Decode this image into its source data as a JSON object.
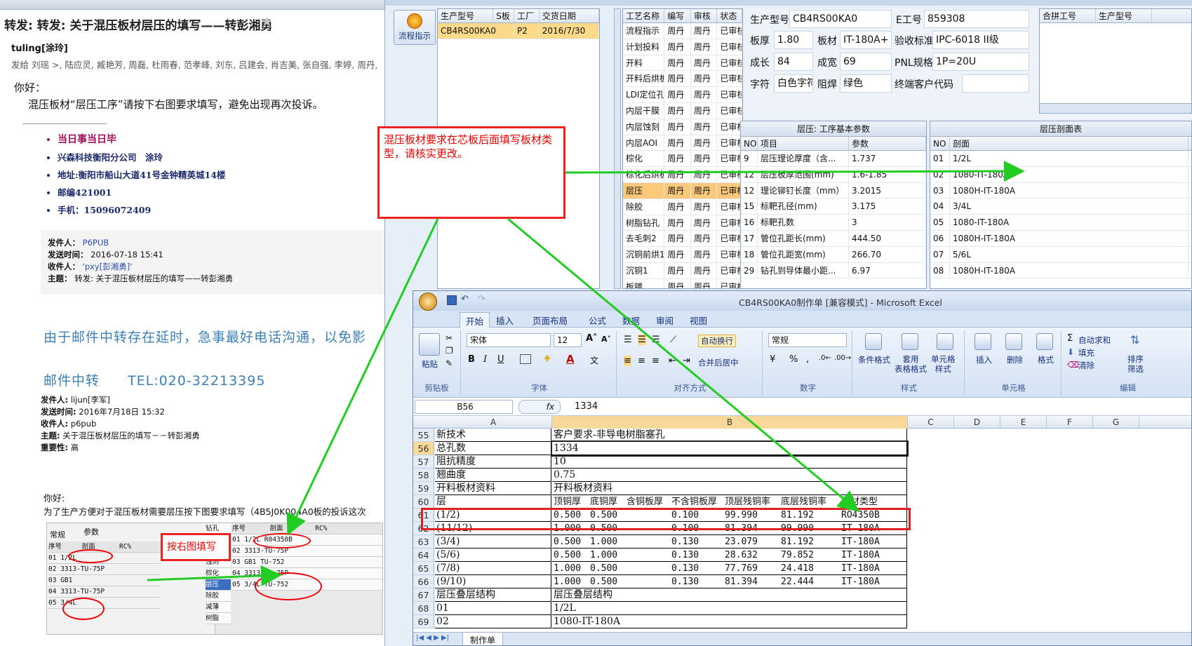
{
  "email": {
    "subject": "转发: 转发: 关于混压板材层压的填写——转彭湘勇",
    "sender": "tuling[涂玲]",
    "recipients": "发给 刘瑶 >, 陆应灵, 臧艳芳, 周磊, 杜雨春, 范孝峰, 刘东, 吕建会, 肖吉美, 张自强, 李婷, 周丹,",
    "greeting": "你好：",
    "request": "混压板材“层压工序”请按下右图要求填写，避免出现再次投诉。",
    "signature": [
      "当日事当日毕",
      "兴森科技衡阳分公司　涂玲",
      "地址:衡阳市船山大道41号金钟精英城14楼",
      "邮编421001",
      "手机：15096072409"
    ],
    "fwd1": {
      "from_k": "发件人：",
      "from": "P6PUB",
      "sent_k": "发送时间：",
      "sent": "2016-07-18 15:41",
      "to_k": "收件人：",
      "to": "'pxy[彭湘勇]'",
      "subj_k": "主题：",
      "subj": "转发: 关于混压板材层压的填写——转彭湘勇"
    },
    "delay_notice": "由于邮件中转存在延时，急事最好电话沟通，以免影",
    "tel": "邮件中转　　TEL:020-32213395",
    "fwd2": {
      "from_k": "发件人:",
      "from": "lijun[李军]",
      "sent_k": "发送时间:",
      "sent": "2016年7月18日 15:32",
      "to_k": "收件人:",
      "to": "p6pub",
      "subj_k": "主题:",
      "subj": "关于混压板材层压的填写－－转彭湘勇",
      "imp_k": "重要性:",
      "imp": "高"
    },
    "greeting2": "你好:",
    "body2": "为了生产方便对于混压板材需要层压按下图要求填写（4B5J0K004A0板的投诉这次",
    "embed": {
      "tabs": [
        "常规",
        "参数"
      ],
      "left_header": [
        "序号",
        "剖面",
        "RC%"
      ],
      "left_rows": [
        [
          "01",
          "1/2L"
        ],
        [
          "02",
          "3313-TU-75P"
        ],
        [
          "03",
          "GB1"
        ],
        [
          "04",
          "3313-TU-75P"
        ],
        [
          "05",
          "3/4L"
        ]
      ],
      "side_items": [
        "钻孔",
        "沉铜",
        "外层",
        "蚀刻",
        "棕化",
        "层压",
        "除胶",
        "减薄",
        "树脂"
      ],
      "right_header": [
        "序号",
        "剖面",
        "RC%"
      ],
      "right_rows": [
        [
          "01",
          "1/2L R04350B"
        ],
        [
          "02",
          "3313-TU-75P"
        ],
        [
          "03",
          "GB1  TU-752"
        ],
        [
          "04",
          "3313-TU-75P"
        ],
        [
          "05",
          "3/4L  TU-752"
        ]
      ],
      "callout": "按右图填写"
    }
  },
  "erp": {
    "flow_button": "流程指示",
    "order_grid": {
      "headers": [
        "生产型号",
        "S板",
        "工厂",
        "交货日期"
      ],
      "rows": [
        [
          "CB4RS00KA0",
          "",
          "P2",
          "2016/7/30"
        ]
      ]
    },
    "process_grid": {
      "headers": [
        "工艺名称",
        "编写",
        "审核",
        "状态"
      ],
      "rows": [
        [
          "流程指示",
          "周丹",
          "周丹",
          "已审核"
        ],
        [
          "计划投料",
          "周丹",
          "周丹",
          "已审核"
        ],
        [
          "开料",
          "周丹",
          "周丹",
          "已审核"
        ],
        [
          "开料后烘板",
          "周丹",
          "周丹",
          "已审核"
        ],
        [
          "LDI定位孔",
          "周丹",
          "周丹",
          "已审核"
        ],
        [
          "内层干膜",
          "周丹",
          "周丹",
          "已审核"
        ],
        [
          "内层蚀刻",
          "周丹",
          "周丹",
          "已审核"
        ],
        [
          "内层AOI",
          "周丹",
          "周丹",
          "已审核"
        ],
        [
          "棕化",
          "周丹",
          "周丹",
          "已审核"
        ],
        [
          "棕化后烘板",
          "周丹",
          "周丹",
          "已审核"
        ],
        [
          "层压",
          "周丹",
          "周丹",
          "已审核"
        ],
        [
          "除胶",
          "周丹",
          "周丹",
          "已审核"
        ],
        [
          "树脂钻孔",
          "周丹",
          "周丹",
          "已审核"
        ],
        [
          "去毛刺2",
          "周丹",
          "周丹",
          "已审核"
        ],
        [
          "沉铜前烘1",
          "周丹",
          "周丹",
          "已审核"
        ],
        [
          "沉铜1",
          "周丹",
          "周丹",
          "已审核"
        ],
        [
          "板镀",
          "周丹",
          "周丹",
          "已审核"
        ]
      ],
      "selected": "层压"
    },
    "info": {
      "prod_model_k": "生产型号",
      "prod_model": "CB4RS00KA0",
      "eno_k": "E工号",
      "eno": "859308",
      "thick_k": "板厚",
      "thick": "1.80",
      "mat_k": "板材",
      "mat": "IT-180A+",
      "std_k": "验收标准",
      "std": "IPC-6018 II级",
      "len_k": "成长",
      "len": "84",
      "wid_k": "成宽",
      "wid": "69",
      "pnl_k": "PNL规格",
      "pnl": "1P=20U",
      "char_k": "字符",
      "char": "白色字符",
      "mask_k": "阻焊",
      "mask": "绿色",
      "cust_k": "终端客户代码",
      "cust": ""
    },
    "combine": {
      "headers": [
        "合拼工号",
        "生产型号"
      ]
    },
    "params": {
      "title": "层压: 工序基本参数",
      "headers": [
        "NO",
        "项目",
        "参数"
      ],
      "rows": [
        [
          "9",
          "层压理论厚度（含...",
          "1.737"
        ],
        [
          "12",
          "层压板厚范围(mm)",
          "1.6-1.85"
        ],
        [
          "12",
          "理论铆钉长度（mm）",
          "3.2015"
        ],
        [
          "15",
          "标靶孔径(mm)",
          "3.175"
        ],
        [
          "16",
          "标靶孔数",
          "3"
        ],
        [
          "17",
          "管位孔距长(mm)",
          "444.50"
        ],
        [
          "18",
          "管位孔距宽(mm)",
          "266.70"
        ],
        [
          "29",
          "钻孔到导体最小距...",
          "6.97"
        ]
      ]
    },
    "stack": {
      "title": "层压剖面表",
      "headers": [
        "NO",
        "剖面"
      ],
      "rows": [
        [
          "01",
          "1/2L"
        ],
        [
          "02",
          "1080-IT-180A"
        ],
        [
          "03",
          "1080H-IT-180A"
        ],
        [
          "04",
          "3/4L"
        ],
        [
          "05",
          "1080-IT-180A"
        ],
        [
          "06",
          "1080H-IT-180A"
        ],
        [
          "07",
          "5/6L"
        ],
        [
          "08",
          "1080H-IT-180A"
        ]
      ]
    }
  },
  "excel": {
    "title": "CB4RS00KA0制作单 [兼容模式] - Microsoft Excel",
    "tabs": [
      "开始",
      "插入",
      "页面布局",
      "公式",
      "数据",
      "审阅",
      "视图"
    ],
    "font_name": "宋体",
    "font_size": "12",
    "number_format": "常规",
    "groups": {
      "clipboard": "剪贴板",
      "font": "字体",
      "align": "对齐方式",
      "number": "数字",
      "style": "样式",
      "cells": "单元格",
      "edit": "编辑"
    },
    "buttons": {
      "paste": "粘贴",
      "wrap": "自动换行",
      "merge": "合并后居中",
      "cond": "条件格式",
      "table": "套用\n表格格式",
      "cellstyle": "单元格\n样式",
      "insert": "插入",
      "delete": "删除",
      "format": "格式",
      "autosum": "自动求和",
      "fill": "填充",
      "clear": "清除",
      "sort": "排序\n筛选"
    },
    "name_box": "B56",
    "fx": "fx",
    "formula": "1334",
    "columns": [
      "A",
      "B",
      "C",
      "D",
      "E",
      "F",
      "G"
    ],
    "rows": [
      {
        "n": "55",
        "a": "新技术",
        "b": "客户要求-非导电树脂塞孔"
      },
      {
        "n": "56",
        "a": "总孔数",
        "b": "1334"
      },
      {
        "n": "57",
        "a": "阻抗精度",
        "b": "10"
      },
      {
        "n": "58",
        "a": "翘曲度",
        "b": "0.75"
      },
      {
        "n": "59",
        "a": "开料板材资料",
        "b": "开料板材资料"
      },
      {
        "n": "60",
        "a": "层",
        "b": "",
        "cols": [
          "顶铜厚",
          "底铜厚",
          "含铜板厚",
          "不含铜板厚",
          "顶层残铜率",
          "底层残铜率",
          "板材类型"
        ]
      },
      {
        "n": "61",
        "a": "(1/2)",
        "b": "",
        "cols": [
          "0.500",
          "0.500",
          "",
          "0.100",
          "99.990",
          "81.192",
          "RO4350B"
        ]
      },
      {
        "n": "62",
        "a": "(11/12)",
        "b": "",
        "cols": [
          "1.000",
          "0.500",
          "",
          "0.100",
          "81.394",
          "99.990",
          "IT-180A"
        ]
      },
      {
        "n": "63",
        "a": "(3/4)",
        "b": "",
        "cols": [
          "0.500",
          "1.000",
          "",
          "0.130",
          "23.079",
          "81.192",
          "IT-180A"
        ]
      },
      {
        "n": "64",
        "a": "(5/6)",
        "b": "",
        "cols": [
          "0.500",
          "1.000",
          "",
          "0.130",
          "28.632",
          "79.852",
          "IT-180A"
        ]
      },
      {
        "n": "65",
        "a": "(7/8)",
        "b": "",
        "cols": [
          "1.000",
          "0.500",
          "",
          "0.130",
          "77.769",
          "24.418",
          "IT-180A"
        ]
      },
      {
        "n": "66",
        "a": "(9/10)",
        "b": "",
        "cols": [
          "1.000",
          "0.500",
          "",
          "0.130",
          "81.394",
          "22.444",
          "IT-180A"
        ]
      },
      {
        "n": "67",
        "a": "层压叠层结构",
        "b": "层压叠层结构"
      },
      {
        "n": "68",
        "a": "01",
        "b": "1/2L"
      },
      {
        "n": "69",
        "a": "02",
        "b": "1080-IT-180A"
      }
    ],
    "sheet_tab": "制作单"
  },
  "main_callout": "混压板材要求在芯板后面填写板材类型，请核实更改。",
  "colors": {
    "accent_red": "#e02020",
    "arrow_green": "#22cc22",
    "link_blue": "#3d7fb7"
  }
}
